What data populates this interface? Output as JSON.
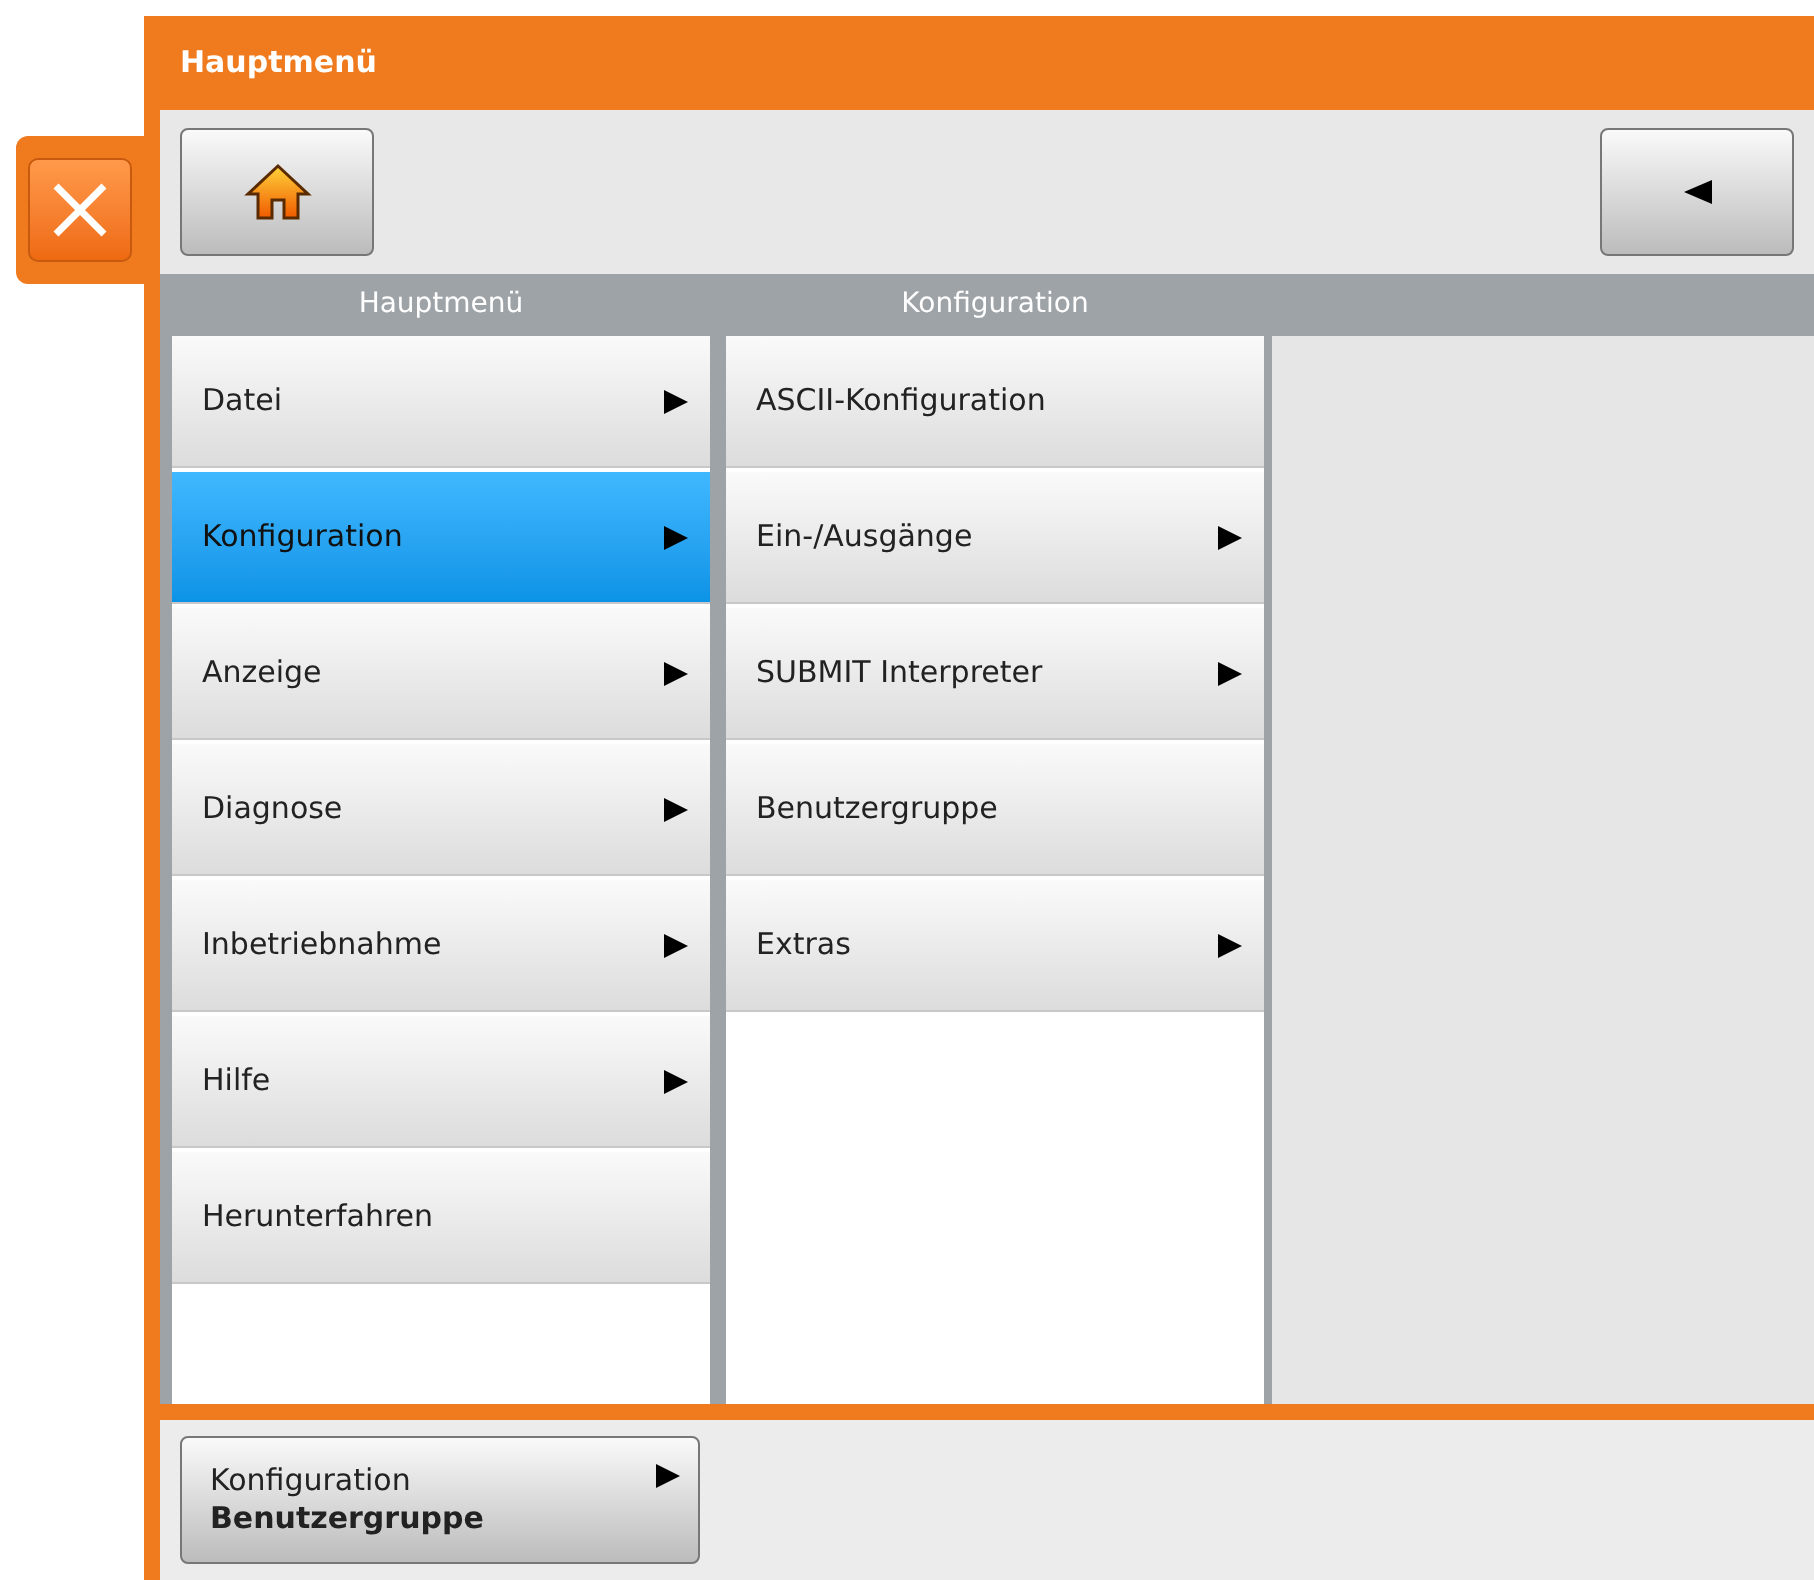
{
  "window": {
    "title": "Hauptmenü"
  },
  "columns": [
    {
      "header": "Hauptmenü",
      "items": [
        {
          "label": "Datei",
          "submenu": true,
          "selected": false
        },
        {
          "label": "Konfiguration",
          "submenu": true,
          "selected": true
        },
        {
          "label": "Anzeige",
          "submenu": true,
          "selected": false
        },
        {
          "label": "Diagnose",
          "submenu": true,
          "selected": false
        },
        {
          "label": "Inbetriebnahme",
          "submenu": true,
          "selected": false
        },
        {
          "label": "Hilfe",
          "submenu": true,
          "selected": false
        },
        {
          "label": "Herunterfahren",
          "submenu": false,
          "selected": false
        }
      ]
    },
    {
      "header": "Konfiguration",
      "items": [
        {
          "label": "ASCII-Konfiguration",
          "submenu": false,
          "selected": false
        },
        {
          "label": "Ein-/Ausgänge",
          "submenu": true,
          "selected": false
        },
        {
          "label": "SUBMIT Interpreter",
          "submenu": true,
          "selected": false
        },
        {
          "label": "Benutzergruppe",
          "submenu": false,
          "selected": false
        },
        {
          "label": "Extras",
          "submenu": true,
          "selected": false
        }
      ]
    }
  ],
  "status": {
    "path": "Konfiguration",
    "current": "Benutzergruppe",
    "submenu": true
  }
}
